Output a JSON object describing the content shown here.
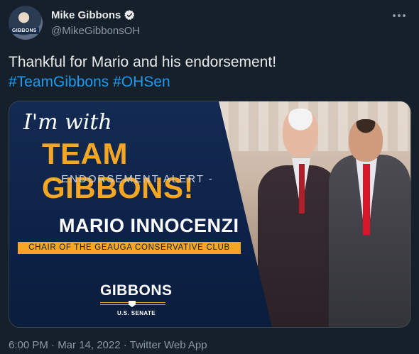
{
  "author": {
    "display_name": "Mike Gibbons",
    "handle": "@MikeGibbonsOH",
    "verified": true,
    "avatar_badge": "GIBBONS"
  },
  "tweet": {
    "text": "Thankful for Mario and his endorsement!",
    "hashtags": [
      "#TeamGibbons",
      "#OHSen"
    ]
  },
  "media": {
    "line1": "I'm with",
    "line2": "TEAM GIBBONS!",
    "line3": "- ENDORSEMENT ALERT -",
    "endorser_name": "MARIO INNOCENZI",
    "endorser_role": "CHAIR OF THE GEAUGA CONSERVATIVE CLUB",
    "logo_text": "GIBBONS",
    "logo_subtext": "U.S. SENATE"
  },
  "meta": {
    "text": "6:00 PM · Mar 14, 2022 · Twitter Web App"
  },
  "colors": {
    "background": "#15202b",
    "accent": "#1d9bf0",
    "graphic_orange": "#f5a623",
    "graphic_navy": "#0d2248"
  },
  "icons": [
    "verified-badge-icon",
    "more-options-icon"
  ]
}
